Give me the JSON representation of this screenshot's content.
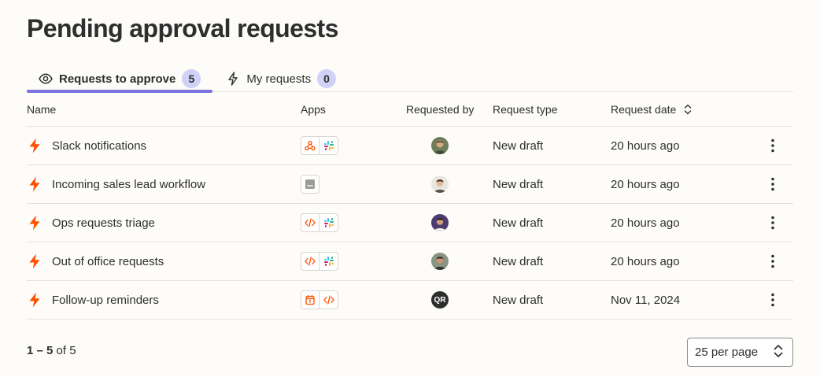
{
  "page": {
    "title": "Pending approval requests"
  },
  "tabs": [
    {
      "label": "Requests to approve",
      "count": "5",
      "icon": "eye-icon",
      "active": true
    },
    {
      "label": "My requests",
      "count": "0",
      "icon": "bolt-outline-icon",
      "active": false
    }
  ],
  "table": {
    "columns": {
      "name": "Name",
      "apps": "Apps",
      "requested_by": "Requested by",
      "request_type": "Request type",
      "request_date": "Request date"
    },
    "rows": [
      {
        "name": "Slack notifications",
        "apps": [
          "webhook-icon",
          "slack-icon"
        ],
        "requester": "avatar-photo",
        "type": "New draft",
        "date": "20 hours ago"
      },
      {
        "name": "Incoming sales lead workflow",
        "apps": [
          "form-icon"
        ],
        "requester": "avatar-photo",
        "type": "New draft",
        "date": "20 hours ago"
      },
      {
        "name": "Ops requests triage",
        "apps": [
          "code-icon",
          "slack-icon"
        ],
        "requester": "avatar-photo",
        "type": "New draft",
        "date": "20 hours ago"
      },
      {
        "name": "Out of office requests",
        "apps": [
          "code-icon",
          "slack-icon"
        ],
        "requester": "avatar-photo",
        "type": "New draft",
        "date": "20 hours ago"
      },
      {
        "name": "Follow-up reminders",
        "apps": [
          "calendar-icon",
          "code-icon"
        ],
        "requester": "QR",
        "type": "New draft",
        "date": "Nov 11, 2024"
      }
    ]
  },
  "footer": {
    "range": "1 – 5",
    "of_text": "of 5",
    "per_page": "25 per page"
  },
  "colors": {
    "accent": "#7b72e0",
    "badge": "#cfd2f7",
    "zap_orange": "#ff4f00",
    "background": "#fdfcf8",
    "divider": "#e4e2da"
  }
}
